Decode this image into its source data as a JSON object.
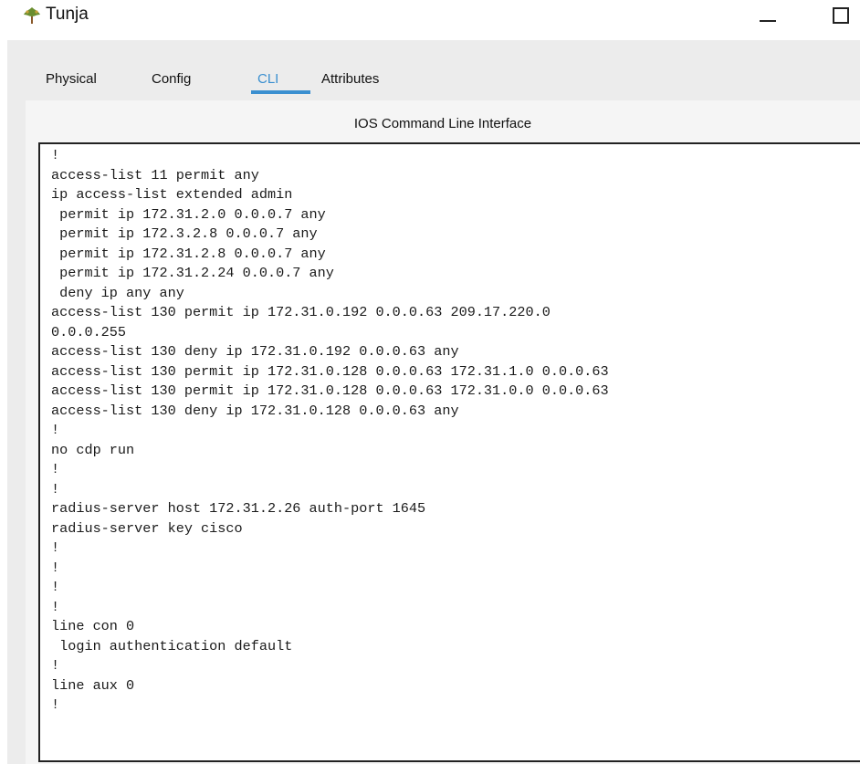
{
  "window": {
    "title": "Tunja",
    "icon": "router-icon"
  },
  "tabs": [
    {
      "label": "Physical",
      "active": false
    },
    {
      "label": "Config",
      "active": false
    },
    {
      "label": "CLI",
      "active": true
    },
    {
      "label": "Attributes",
      "active": false
    }
  ],
  "cli": {
    "heading": "IOS Command Line Interface",
    "lines": [
      "!",
      "access-list 11 permit any",
      "ip access-list extended admin",
      " permit ip 172.31.2.0 0.0.0.7 any",
      " permit ip 172.3.2.8 0.0.0.7 any",
      " permit ip 172.31.2.8 0.0.0.7 any",
      " permit ip 172.31.2.24 0.0.0.7 any",
      " deny ip any any",
      "access-list 130 permit ip 172.31.0.192 0.0.0.63 209.17.220.0",
      "0.0.0.255",
      "access-list 130 deny ip 172.31.0.192 0.0.0.63 any",
      "access-list 130 permit ip 172.31.0.128 0.0.0.63 172.31.1.0 0.0.0.63",
      "access-list 130 permit ip 172.31.0.128 0.0.0.63 172.31.0.0 0.0.0.63",
      "access-list 130 deny ip 172.31.0.128 0.0.0.63 any",
      "!",
      "no cdp run",
      "!",
      "!",
      "radius-server host 172.31.2.26 auth-port 1645",
      "radius-server key cisco",
      "!",
      "!",
      "!",
      "!",
      "line con 0",
      " login authentication default",
      "!",
      "line aux 0",
      "!"
    ]
  },
  "colors": {
    "accent": "#3a8fd0",
    "window_bg": "#ececec",
    "terminal_bg": "#ffffff"
  }
}
